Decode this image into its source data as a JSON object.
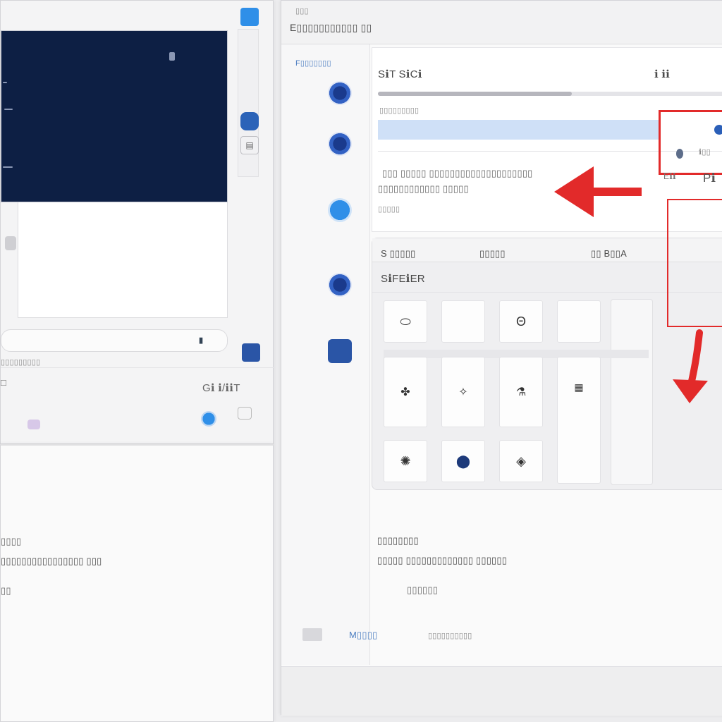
{
  "left": {
    "label_row1": "▯▯▯▯▯▯▯▯▯",
    "label_row2": "□",
    "label_row3": "Gℹ ℹ/ℹℹT",
    "lower_label1": "▯▯▯▯",
    "lower_label2": "▯▯▯▯▯▯▯▯▯▯▯▯▯▯▯▯ ▯▯▯",
    "lower_label3": "▯▯"
  },
  "right": {
    "header_line1": "▯▯▯",
    "header_line2": "E▯▯▯▯▯▯▯▯▯▯▯ ▯▯",
    "sidebar_label": "F▯▯▯▯▯▯▯",
    "card_title": "SℹT SℹCℹ",
    "card_title_right": "ℹ ℹℹ",
    "row_label1": "▯▯▯▯▯▯▯▯▯",
    "row_label2": "▯▯▯ ▯▯▯▯▯ ▯▯▯▯▯▯▯▯▯▯▯▯▯▯▯▯▯▯▯▯",
    "row_label3": "▯▯▯▯▯▯▯▯▯▯▯▯ ▯▯▯▯▯",
    "row_label4": "▯▯▯▯▯",
    "grid_head": [
      "S ▯▯▯▯▯",
      "▯▯▯▯▯",
      "▯▯ B▯▯A"
    ],
    "grid_subhead": "SℹFEℹER",
    "tiles_row1": [
      "⬭",
      "",
      "Θ",
      "",
      ""
    ],
    "tiles_row2": [
      "✤",
      "✧",
      "⚗",
      "▦",
      ""
    ],
    "tiles_row3": [
      "✺",
      "⬤",
      "◈"
    ],
    "bottom_label1": "▯▯▯▯▯▯▯▯",
    "bottom_label2": "▯▯▯▯▯ ▯▯▯▯▯▯▯▯▯▯▯▯▯ ▯▯▯▯▯▯",
    "bottom_label3": "▯▯▯▯▯▯",
    "footer_label1": "M▯▯▯▯",
    "footer_label2": "▯▯▯▯▯▯▯▯▯▯"
  },
  "annotations": {
    "red_box_label1": "Eℹℹ",
    "red_box_label2": "Pℹ",
    "red_box_label3": "ℹ▯▯"
  },
  "progress": {
    "fraction": 0.55
  },
  "colors": {
    "accent_blue": "#2f8fe8",
    "navy": "#0d1f44",
    "annotation_red": "#e22a2a",
    "selection": "#cfe0f7"
  },
  "icons": {
    "left_top_button": "blue-square-icon",
    "left_side_button_1": "globe-icon",
    "left_side_button_2": "document-icon",
    "left_bottom_button": "square-app-icon",
    "left_dot": "blue-dot-icon",
    "sidebar_icons": [
      "globe-icon",
      "camera-icon",
      "blue-dot-icon",
      "globe-icon",
      "app-square-icon"
    ]
  }
}
